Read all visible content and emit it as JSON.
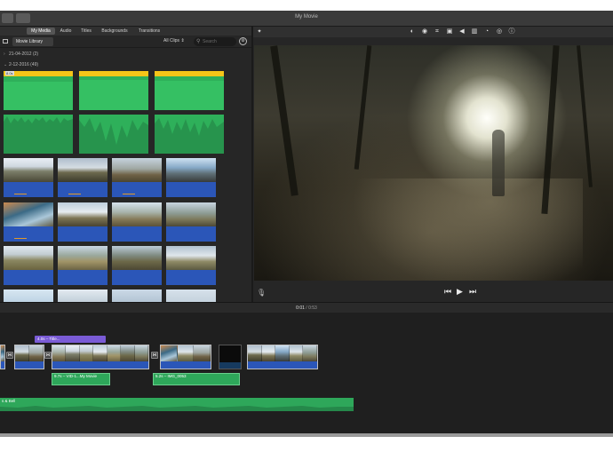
{
  "window": {
    "title": "My Movie"
  },
  "media_tabs": [
    {
      "label": "My Media",
      "active": true
    },
    {
      "label": "Audio",
      "active": false
    },
    {
      "label": "Titles",
      "active": false
    },
    {
      "label": "Backgrounds",
      "active": false
    },
    {
      "label": "Transitions",
      "active": false
    }
  ],
  "library": {
    "label": "Movie Library",
    "filter": "All Clips ⇕",
    "search_placeholder": "Search",
    "events": [
      {
        "label": "21-04-2012  (2)"
      },
      {
        "label": "2-12-2016  (49)"
      }
    ],
    "audio_clip_tag": "8.0s"
  },
  "viewer_tools": [
    {
      "icon": "color-balance-icon",
      "glyph": "◐"
    },
    {
      "icon": "color-correction-icon",
      "glyph": "◉"
    },
    {
      "icon": "crop-icon",
      "glyph": "⌗"
    },
    {
      "icon": "stabilization-icon",
      "glyph": "▣"
    },
    {
      "icon": "volume-icon",
      "glyph": "◀"
    },
    {
      "icon": "noise-reduction-icon",
      "glyph": "▥"
    },
    {
      "icon": "speed-icon",
      "glyph": "◔"
    },
    {
      "icon": "filter-icon",
      "glyph": "◎"
    },
    {
      "icon": "info-icon",
      "glyph": "ⓘ"
    }
  ],
  "playback": {
    "previous_glyph": "⏮",
    "play_glyph": "▶",
    "next_glyph": "⏭",
    "current_time": "0:01",
    "total_time": "0:53"
  },
  "timeline": {
    "title_clip_label": "4.0s – Title...",
    "audio_clips": [
      {
        "label": "9.7s – VID-1...My Movie"
      },
      {
        "label": "5.2s – IMG_0053"
      }
    ],
    "music_label": "s & Bell"
  }
}
